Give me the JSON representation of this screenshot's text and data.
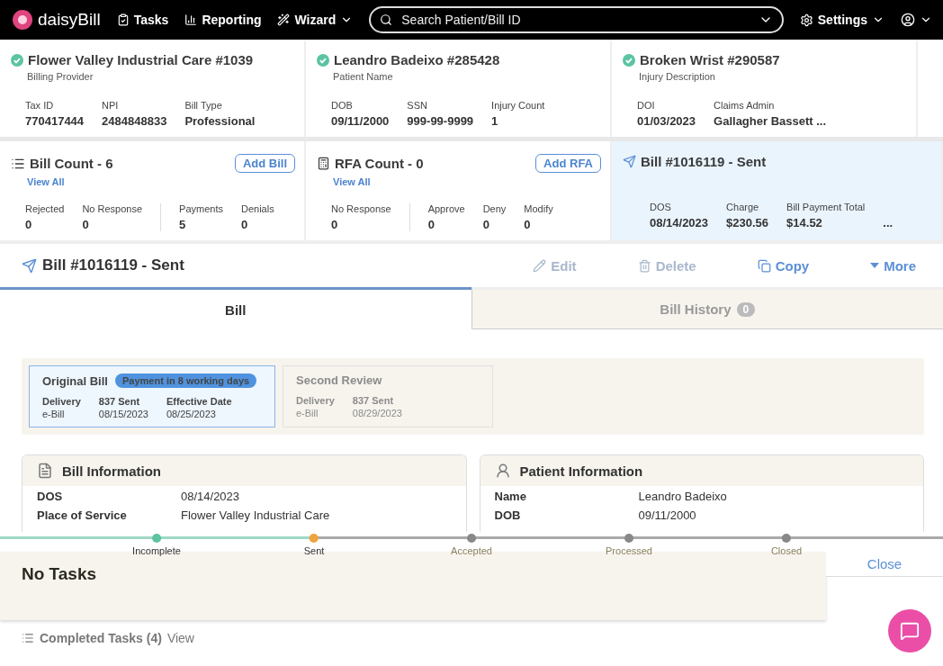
{
  "nav": {
    "logo": "daisyBill",
    "items": [
      {
        "label": "Tasks",
        "kind": "tasks",
        "dropdown": false
      },
      {
        "label": "Reporting",
        "kind": "reporting",
        "dropdown": false
      },
      {
        "label": "Wizard",
        "kind": "wizard",
        "dropdown": true
      }
    ],
    "search": {
      "placeholder": "Search Patient/Bill ID"
    },
    "settings": "Settings"
  },
  "summary": [
    {
      "title": "Flower Valley Industrial Care #1039",
      "subtitle": "Billing Provider",
      "verified": true,
      "fields": [
        {
          "label": "Tax ID",
          "value": "770417444"
        },
        {
          "label": "NPI",
          "value": "2484848833"
        },
        {
          "label": "Bill Type",
          "value": "Professional"
        }
      ]
    },
    {
      "title": "Leandro Badeixo #285428",
      "subtitle": "Patient Name",
      "verified": true,
      "fields": [
        {
          "label": "DOB",
          "value": "09/11/2000"
        },
        {
          "label": "SSN",
          "value": "999-99-9999"
        },
        {
          "label": "Injury Count",
          "value": "1"
        }
      ]
    },
    {
      "title": "Broken Wrist #290587",
      "subtitle": "Injury Description",
      "verified": true,
      "fields": [
        {
          "label": "DOI",
          "value": "01/03/2023"
        },
        {
          "label": "Claims Admin",
          "value": "Gallagher Bassett ..."
        }
      ]
    }
  ],
  "counts": [
    {
      "kind": "bills",
      "title": "Bill Count - 6",
      "action": "Add Bill",
      "link": "View All",
      "groups": [
        [
          {
            "label": "Rejected",
            "value": "0"
          },
          {
            "label": "No Response",
            "value": "0"
          }
        ],
        [
          {
            "label": "Payments",
            "value": "5"
          },
          {
            "label": "Denials",
            "value": "0"
          }
        ]
      ]
    },
    {
      "kind": "rfa",
      "title": "RFA Count - 0",
      "action": "Add RFA",
      "link": "View All",
      "groups": [
        [
          {
            "label": "No Response",
            "value": "0"
          }
        ],
        [
          {
            "label": "Approve",
            "value": "0"
          },
          {
            "label": "Deny",
            "value": "0"
          },
          {
            "label": "Modify",
            "value": "0"
          }
        ]
      ]
    }
  ],
  "current_bill": {
    "title": "Bill #1016119 - Sent",
    "selected": true,
    "fields": [
      {
        "label": "DOS",
        "value": "08/14/2023"
      },
      {
        "label": "Charge",
        "value": "$230.56"
      },
      {
        "label": "Bill Payment Total",
        "value": "$14.52"
      }
    ],
    "more": "..."
  },
  "bill_header": {
    "title": "Bill #1016119 - Sent",
    "actions": [
      {
        "kind": "edit",
        "label": "Edit",
        "disabled": true
      },
      {
        "kind": "delete",
        "label": "Delete",
        "disabled": true
      },
      {
        "kind": "copy",
        "label": "Copy",
        "disabled": false
      },
      {
        "kind": "more",
        "label": "More",
        "disabled": false
      }
    ]
  },
  "tabs": [
    {
      "label": "Bill",
      "selected": true
    },
    {
      "label": "Bill History",
      "selected": false,
      "badge": "0"
    }
  ],
  "revisions": [
    {
      "title": "Original Bill",
      "badge": "Payment in 8 working days",
      "selected": true,
      "fields": [
        {
          "label": "Delivery",
          "value": "e-Bill"
        },
        {
          "label": "837 Sent",
          "value": "08/15/2023"
        },
        {
          "label": "Effective Date",
          "value": "08/25/2023"
        }
      ]
    },
    {
      "title": "Second Review",
      "selected": false,
      "fields": [
        {
          "label": "Delivery",
          "value": "e-Bill"
        },
        {
          "label": "837 Sent",
          "value": "08/29/2023"
        }
      ]
    }
  ],
  "info_cards": [
    {
      "kind": "bill",
      "title": "Bill Information",
      "rows": [
        {
          "label": "DOS",
          "value": "08/14/2023"
        },
        {
          "label": "Place of Service",
          "value": "Flower Valley Industrial Care"
        }
      ]
    },
    {
      "kind": "patient",
      "title": "Patient Information",
      "rows": [
        {
          "label": "Name",
          "value": "Leandro Badeixo"
        },
        {
          "label": "DOB",
          "value": "09/11/2000"
        }
      ]
    }
  ],
  "progress": [
    {
      "label": "Incomplete",
      "done": true,
      "current": false
    },
    {
      "label": "Sent",
      "done": false,
      "current": true
    },
    {
      "label": "Accepted",
      "done": false,
      "current": false
    },
    {
      "label": "Processed",
      "done": false,
      "current": false
    },
    {
      "label": "Closed",
      "done": false,
      "current": false
    }
  ],
  "tasks": {
    "message": "No Tasks",
    "close": "Close",
    "completed": "Completed Tasks (4)",
    "view": "View"
  }
}
